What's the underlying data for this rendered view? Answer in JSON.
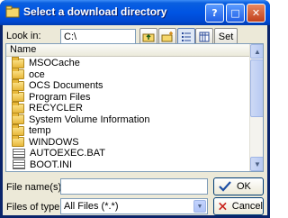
{
  "window": {
    "title": "Select a download directory",
    "buttons": {
      "help": "?",
      "maximize": "□",
      "close": "✕"
    }
  },
  "lookin": {
    "label": "Look in:",
    "path": "C:\\"
  },
  "toolbar": {
    "icons": [
      "up-folder-icon",
      "new-folder-icon",
      "list-view-icon",
      "details-view-icon"
    ],
    "set_label": "Set"
  },
  "list": {
    "column_name": "Name",
    "items": [
      {
        "name": "MSOCache",
        "type": "folder"
      },
      {
        "name": "oce",
        "type": "folder"
      },
      {
        "name": "OCS Documents",
        "type": "folder"
      },
      {
        "name": "Program Files",
        "type": "folder"
      },
      {
        "name": "RECYCLER",
        "type": "folder"
      },
      {
        "name": "System Volume Information",
        "type": "folder"
      },
      {
        "name": "temp",
        "type": "folder"
      },
      {
        "name": "WINDOWS",
        "type": "folder"
      },
      {
        "name": "AUTOEXEC.BAT",
        "type": "file"
      },
      {
        "name": "BOOT.INI",
        "type": "file"
      }
    ]
  },
  "filename": {
    "label": "File name(s):",
    "value": ""
  },
  "filetype": {
    "label": "Files of type:",
    "value": "All Files (*.*)"
  },
  "actions": {
    "ok_label": "OK",
    "cancel_label": "Cancel"
  },
  "colors": {
    "title_bar": "#0054e3",
    "dialog_bg": "#ece9d8",
    "field_border": "#7f9db9"
  }
}
